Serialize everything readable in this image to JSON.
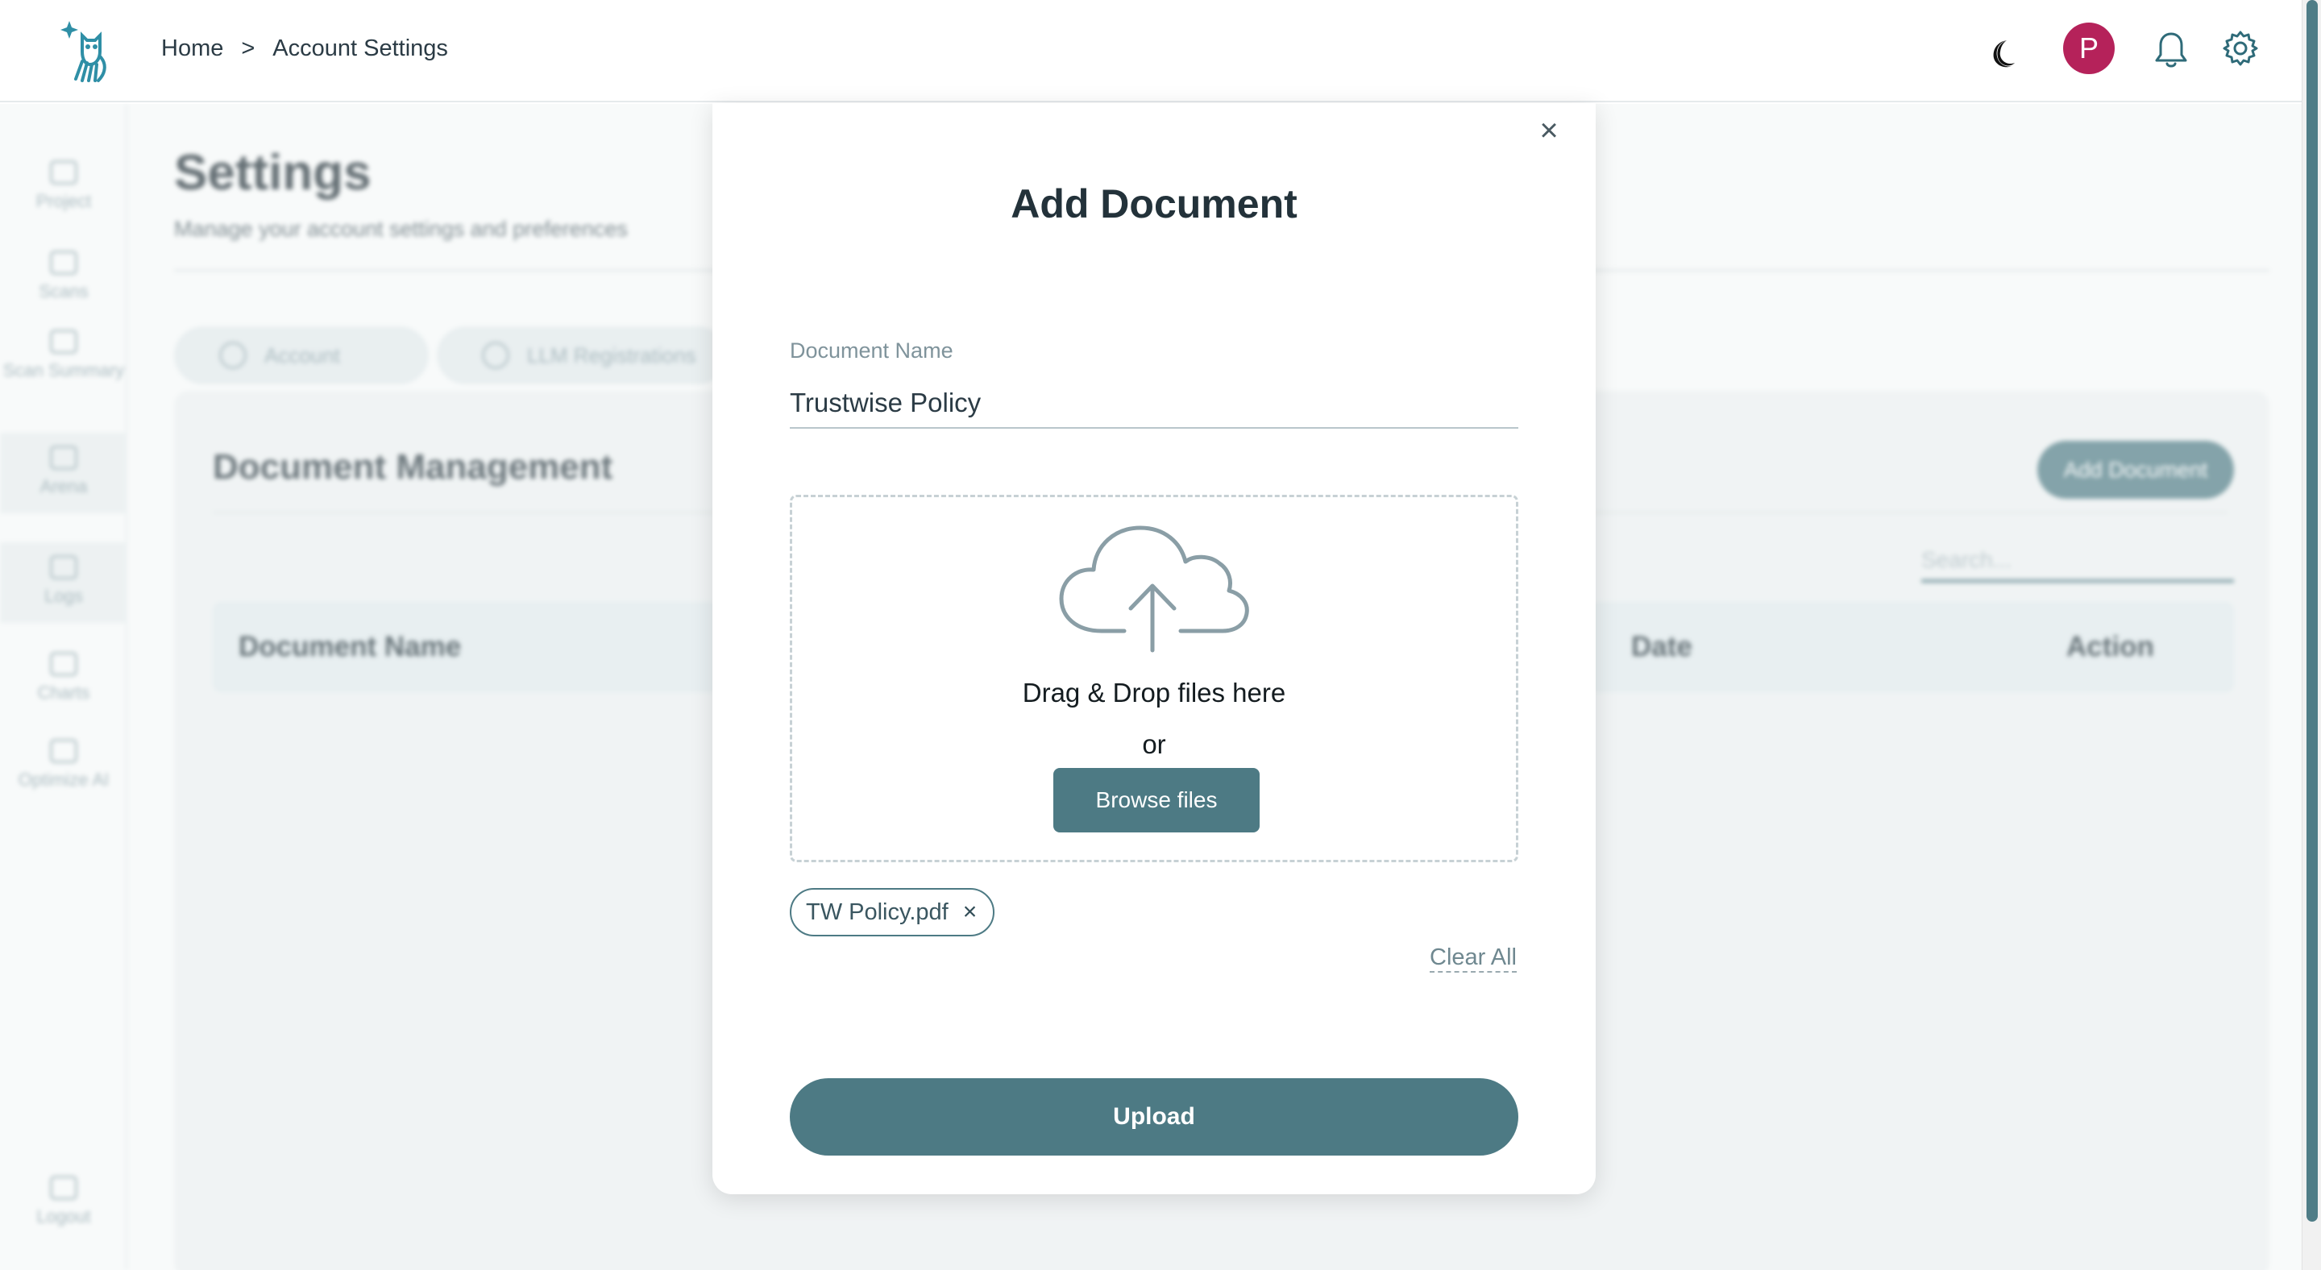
{
  "header": {
    "breadcrumb": [
      "Home",
      ">",
      "Account Settings"
    ],
    "avatar_initial": "P",
    "icons": [
      "logo-icon",
      "moon-icon",
      "bell-icon",
      "gear-icon"
    ]
  },
  "sidebar": {
    "items": [
      {
        "label": "Project",
        "icon": "grid-icon"
      },
      {
        "label": "Scans",
        "icon": "scan-icon"
      },
      {
        "label": "Scan Summary",
        "icon": "document-icon"
      },
      {
        "label": "Arena",
        "icon": "people-icon"
      },
      {
        "label": "Logs",
        "icon": "calendar-icon"
      },
      {
        "label": "Charts",
        "icon": "chart-icon"
      },
      {
        "label": "Optimize AI",
        "icon": "optimize-icon"
      }
    ],
    "logout_label": "Logout"
  },
  "page": {
    "title": "Settings",
    "subtitle": "Manage your account settings and preferences",
    "tabs": [
      {
        "label": "Account"
      },
      {
        "label": "LLM Registrations"
      }
    ]
  },
  "documents": {
    "title": "Document Management",
    "add_button": "Add Document",
    "search_placeholder": "Search...",
    "columns": [
      "Document Name",
      "Date",
      "Action"
    ]
  },
  "modal": {
    "title": "Add Document",
    "close_symbol": "×",
    "field_label": "Document Name",
    "field_value": "Trustwise Policy",
    "drop_text": "Drag & Drop files here",
    "or_text": "or",
    "browse_label": "Browse files",
    "files": [
      {
        "name": "TW Policy.pdf",
        "remove": "×"
      }
    ],
    "clear_all": "Clear All",
    "upload_label": "Upload"
  },
  "colors": {
    "accent": "#4d7a84",
    "avatar": "#b5225a"
  }
}
